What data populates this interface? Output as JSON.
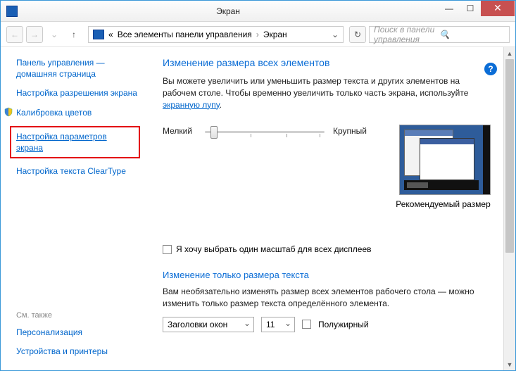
{
  "window": {
    "title": "Экран"
  },
  "nav": {
    "breadcrumb_prefix": "«",
    "breadcrumb1": "Все элементы панели управления",
    "breadcrumb2": "Экран",
    "search_placeholder": "Поиск в панели управления"
  },
  "sidebar": {
    "home": "Панель управления — домашняя страница",
    "resolution": "Настройка разрешения экрана",
    "calibration": "Калибровка цветов",
    "params": "Настройка параметров экрана",
    "cleartype": "Настройка текста ClearType",
    "see_also": "См. также",
    "personalization": "Персонализация",
    "devices": "Устройства и принтеры"
  },
  "main": {
    "heading": "Изменение размера всех элементов",
    "desc1": "Вы можете увеличить или уменьшить размер текста и других элементов на рабочем столе. Чтобы временно увеличить только часть экрана, используйте ",
    "magnifier_link": "экранную лупу",
    "slider_min": "Мелкий",
    "slider_max": "Крупный",
    "recommended": "Рекомендуемый размер",
    "checkbox_label": "Я хочу выбрать один масштаб для всех дисплеев",
    "heading2": "Изменение только размера текста",
    "desc2": "Вам необязательно изменять размер всех элементов рабочего стола — можно изменить только размер текста определённого элемента.",
    "select_element": "Заголовки окон",
    "select_size": "11",
    "bold_label": "Полужирный"
  }
}
